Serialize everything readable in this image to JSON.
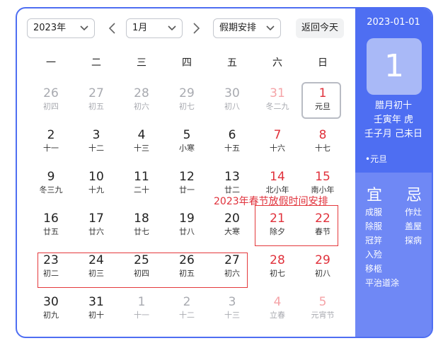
{
  "toolbar": {
    "year_value": "2023年",
    "month_value": "1月",
    "holiday_value": "假期安排",
    "today_label": "返回今天"
  },
  "weekdays": [
    "一",
    "二",
    "三",
    "四",
    "五",
    "六",
    "日"
  ],
  "weeks": [
    [
      {
        "day": "26",
        "lunar": "初四",
        "other": true
      },
      {
        "day": "27",
        "lunar": "初五",
        "other": true
      },
      {
        "day": "28",
        "lunar": "初六",
        "other": true
      },
      {
        "day": "29",
        "lunar": "初七",
        "other": true
      },
      {
        "day": "30",
        "lunar": "初八",
        "other": true
      },
      {
        "day": "31",
        "lunar": "冬二九",
        "other": true,
        "weekend": true
      },
      {
        "day": "1",
        "lunar": "元旦",
        "weekend": true,
        "selected": true,
        "holiday": true
      }
    ],
    [
      {
        "day": "2",
        "lunar": "十一"
      },
      {
        "day": "3",
        "lunar": "十二"
      },
      {
        "day": "4",
        "lunar": "十三"
      },
      {
        "day": "5",
        "lunar": "小寒"
      },
      {
        "day": "6",
        "lunar": "十五"
      },
      {
        "day": "7",
        "lunar": "十六",
        "weekend": true
      },
      {
        "day": "8",
        "lunar": "十七",
        "weekend": true
      }
    ],
    [
      {
        "day": "9",
        "lunar": "冬三九"
      },
      {
        "day": "10",
        "lunar": "十九"
      },
      {
        "day": "11",
        "lunar": "二十"
      },
      {
        "day": "12",
        "lunar": "廿一"
      },
      {
        "day": "13",
        "lunar": "廿二"
      },
      {
        "day": "14",
        "lunar": "北小年",
        "weekend": true
      },
      {
        "day": "15",
        "lunar": "南小年",
        "weekend": true
      }
    ],
    [
      {
        "day": "16",
        "lunar": "廿五"
      },
      {
        "day": "17",
        "lunar": "廿六"
      },
      {
        "day": "18",
        "lunar": "廿七"
      },
      {
        "day": "19",
        "lunar": "廿八"
      },
      {
        "day": "20",
        "lunar": "大寒"
      },
      {
        "day": "21",
        "lunar": "除夕",
        "weekend": true
      },
      {
        "day": "22",
        "lunar": "春节",
        "weekend": true
      }
    ],
    [
      {
        "day": "23",
        "lunar": "初二"
      },
      {
        "day": "24",
        "lunar": "初三"
      },
      {
        "day": "25",
        "lunar": "初四"
      },
      {
        "day": "26",
        "lunar": "初五"
      },
      {
        "day": "27",
        "lunar": "初六"
      },
      {
        "day": "28",
        "lunar": "初七",
        "weekend": true
      },
      {
        "day": "29",
        "lunar": "初八",
        "weekend": true
      }
    ],
    [
      {
        "day": "30",
        "lunar": "初九"
      },
      {
        "day": "31",
        "lunar": "初十"
      },
      {
        "day": "1",
        "lunar": "十一",
        "other": true
      },
      {
        "day": "2",
        "lunar": "十二",
        "other": true
      },
      {
        "day": "3",
        "lunar": "十三",
        "other": true
      },
      {
        "day": "4",
        "lunar": "立春",
        "other": true,
        "weekend": true
      },
      {
        "day": "5",
        "lunar": "元宵节",
        "other": true,
        "weekend": true
      }
    ]
  ],
  "annotation": "2023年春节放假时间安排",
  "detail": {
    "date": "2023-01-01",
    "day": "1",
    "lunar_date": "腊月初十",
    "year_ganzhi": "壬寅年 虎",
    "month_day_ganzhi": "壬子月 己未日",
    "festival": "•元旦",
    "yi_label": "宜",
    "ji_label": "忌",
    "yi": [
      "成服",
      "除服",
      "冠笄",
      "入殓",
      "移柩",
      "平治道涂"
    ],
    "ji": [
      "作灶",
      "盖屋",
      "探病"
    ]
  },
  "colors": {
    "accent": "#4e6ef2",
    "holiday_red": "#e0313b",
    "panel_light": "#6f88f5"
  }
}
